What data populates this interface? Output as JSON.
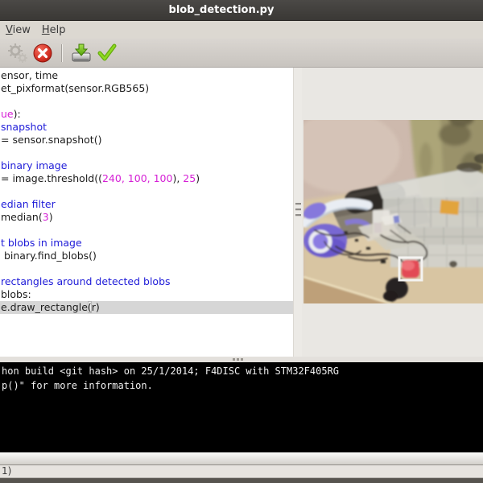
{
  "window": {
    "title": "blob_detection.py"
  },
  "menu": {
    "items": [
      {
        "label": "View"
      },
      {
        "label": "Help"
      }
    ]
  },
  "toolbar": {
    "icons": [
      "gears-icon",
      "stop-icon",
      "save-to-drive-icon",
      "run-check-icon"
    ]
  },
  "editor": {
    "lines": [
      {
        "segs": [
          [
            "k",
            "ensor, time"
          ]
        ]
      },
      {
        "segs": [
          [
            "k",
            "et_pixformat(sensor.RGB565)"
          ]
        ]
      },
      {
        "segs": []
      },
      {
        "segs": [
          [
            "m",
            "ue"
          ],
          [
            "k",
            "):"
          ]
        ]
      },
      {
        "segs": [
          [
            "c",
            "snapshot"
          ]
        ]
      },
      {
        "segs": [
          [
            "k",
            "= sensor.snapshot()"
          ]
        ]
      },
      {
        "segs": []
      },
      {
        "segs": [
          [
            "c",
            "binary image"
          ]
        ]
      },
      {
        "segs": [
          [
            "k",
            "= image.threshold(("
          ],
          [
            "m",
            "240, 100, 100"
          ],
          [
            "k",
            "), "
          ],
          [
            "m",
            "25"
          ],
          [
            "k",
            ")"
          ]
        ]
      },
      {
        "segs": []
      },
      {
        "segs": [
          [
            "c",
            "edian filter"
          ]
        ]
      },
      {
        "segs": [
          [
            "k",
            "median("
          ],
          [
            "m",
            "3"
          ],
          [
            "k",
            ")"
          ]
        ]
      },
      {
        "segs": []
      },
      {
        "segs": [
          [
            "c",
            "t blobs in image"
          ]
        ]
      },
      {
        "segs": [
          [
            "k",
            " binary.find_blobs()"
          ]
        ]
      },
      {
        "segs": []
      },
      {
        "segs": [
          [
            "c",
            "rectangles around detected blobs"
          ]
        ]
      },
      {
        "segs": [
          [
            "k",
            "blobs:"
          ]
        ]
      },
      {
        "segs": [
          [
            "k",
            "e.draw_rectangle"
          ],
          [
            "p",
            "("
          ],
          [
            "k",
            "r)"
          ]
        ],
        "highlight": true
      }
    ]
  },
  "terminal": {
    "lines": [
      "hon build <git hash> on 25/1/2014; F4DISC with STM32F405RG",
      "p()\" for more information."
    ]
  },
  "statusbar": {
    "text": "1)"
  },
  "colors": {
    "titlebar": "#3a3835",
    "titlebar_hi": "#4b4946",
    "comment_blue": "#1f1cd8",
    "magenta": "#d51fd5",
    "highlight_line": "#d6d6d6",
    "terminal_bg": "#000000",
    "terminal_text": "#f0f0f0",
    "accent_green": "#73d216",
    "stop_red": "#cc1f1f"
  },
  "camera": {
    "colors": {
      "wall": "#cdb9ad",
      "curtain": "#aca578",
      "desk": "#d8c5a2",
      "desk_front": "#bea079",
      "cylinder": "#2d2926",
      "board": "#878072",
      "headband": "#e9edf3",
      "earcup": "#7868d2",
      "ring": "#ecedf1",
      "boxes": "#cfcfc8",
      "sticky": "#e2a43e",
      "wire": "#3a332c",
      "blob": "#e24854",
      "blob_box": "#f4f3f1"
    }
  }
}
